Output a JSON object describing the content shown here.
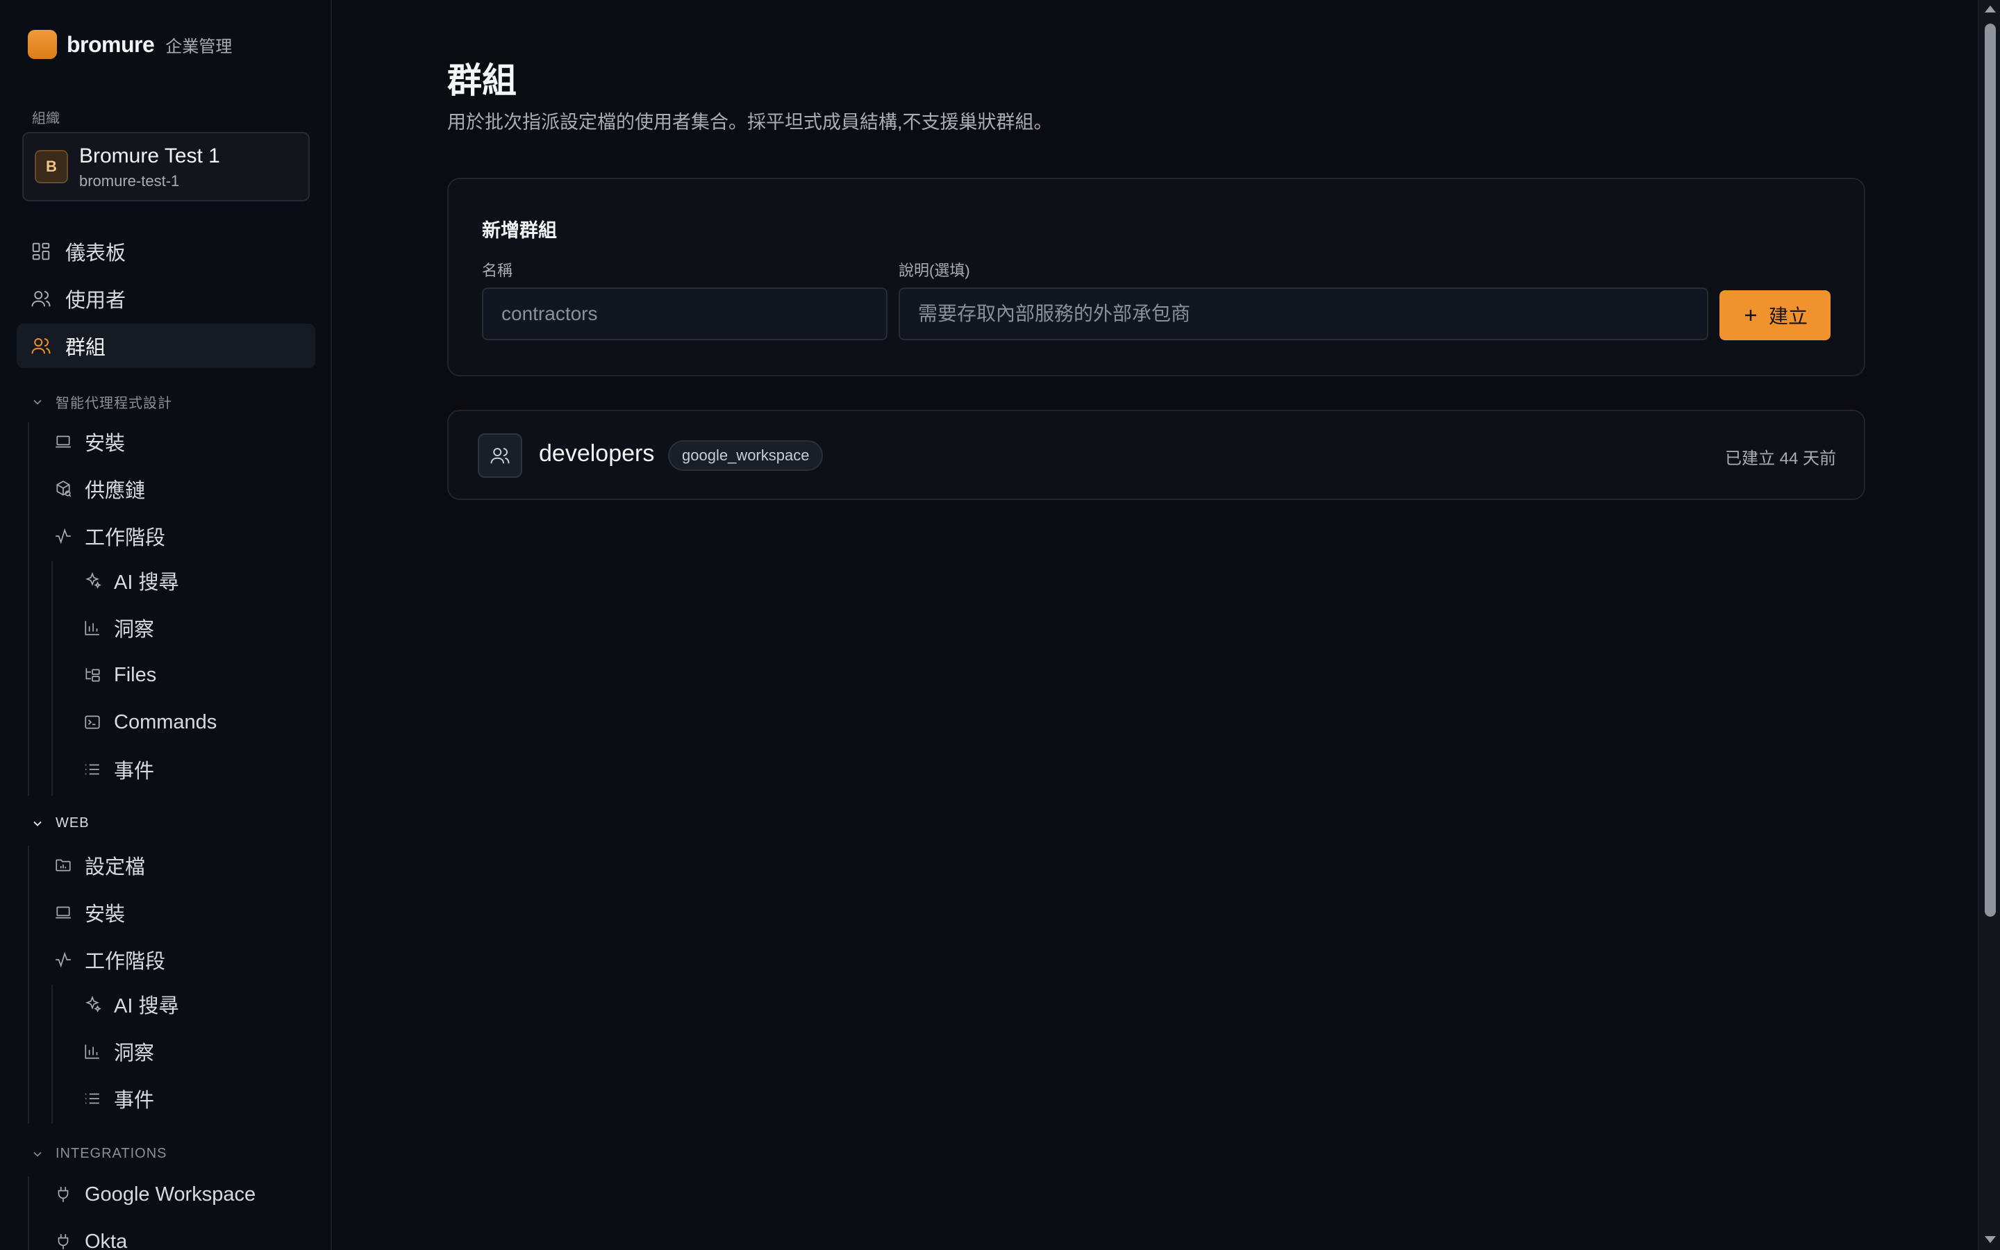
{
  "brand": {
    "name": "bromure",
    "subtitle": "企業管理",
    "accent": "#f0922e"
  },
  "org": {
    "label": "組織",
    "avatar_letter": "B",
    "name": "Bromure Test 1",
    "slug": "bromure-test-1"
  },
  "nav": {
    "dashboard": "儀表板",
    "users": "使用者",
    "groups": "群組"
  },
  "sections": {
    "agent": {
      "title": "智能代理程式設計",
      "install": "安裝",
      "supply_chain": "供應鏈",
      "sessions": "工作階段",
      "ai_search": "AI 搜尋",
      "insights": "洞察",
      "files": "Files",
      "commands": "Commands",
      "events": "事件"
    },
    "web": {
      "title": "WEB",
      "profiles": "設定檔",
      "install": "安裝",
      "sessions": "工作階段",
      "ai_search": "AI 搜尋",
      "insights": "洞察",
      "events": "事件"
    },
    "integrations": {
      "title": "INTEGRATIONS",
      "google": "Google Workspace",
      "okta": "Okta"
    }
  },
  "page": {
    "title": "群組",
    "subtitle": "用於批次指派設定檔的使用者集合。採平坦式成員結構,不支援巢狀群組。"
  },
  "new_group": {
    "title": "新增群組",
    "name_label": "名稱",
    "name_placeholder": "contractors",
    "desc_label": "說明(選填)",
    "desc_placeholder": "需要存取內部服務的外部承包商",
    "create_label": "建立"
  },
  "groups": [
    {
      "name": "developers",
      "source": "google_workspace",
      "created": "已建立 44 天前"
    }
  ]
}
